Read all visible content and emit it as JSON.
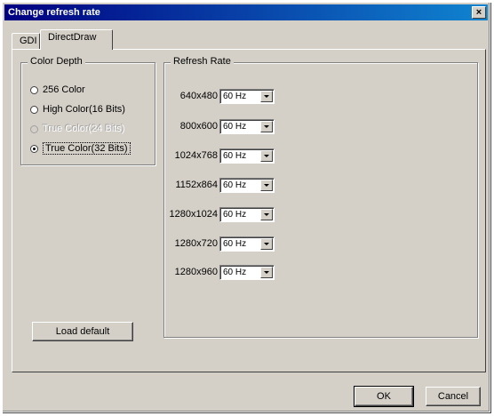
{
  "window": {
    "title": "Change refresh rate",
    "close_label": "×"
  },
  "tabs": [
    {
      "label": "GDI",
      "active": false
    },
    {
      "label": "DirectDraw",
      "active": true
    }
  ],
  "color_depth": {
    "title": "Color Depth",
    "options": [
      {
        "label": "256 Color",
        "checked": false,
        "disabled": false
      },
      {
        "label": "High Color(16 Bits)",
        "checked": false,
        "disabled": false
      },
      {
        "label": "True Color(24 Bits)",
        "checked": false,
        "disabled": true
      },
      {
        "label": "True Color(32 Bits)",
        "checked": true,
        "disabled": false
      }
    ]
  },
  "refresh_rate": {
    "title": "Refresh Rate",
    "rows": [
      {
        "resolution": "640x480",
        "value": "60 Hz"
      },
      {
        "resolution": "800x600",
        "value": "60 Hz"
      },
      {
        "resolution": "1024x768",
        "value": "60 Hz"
      },
      {
        "resolution": "1152x864",
        "value": "60 Hz"
      },
      {
        "resolution": "1280x1024",
        "value": "60 Hz"
      },
      {
        "resolution": "1280x720",
        "value": "60 Hz"
      },
      {
        "resolution": "1280x960",
        "value": "60 Hz"
      }
    ]
  },
  "buttons": {
    "load_default": "Load default",
    "ok": "OK",
    "cancel": "Cancel"
  },
  "icons": {
    "close": "close-icon",
    "dropdown": "chevron-down-icon"
  }
}
